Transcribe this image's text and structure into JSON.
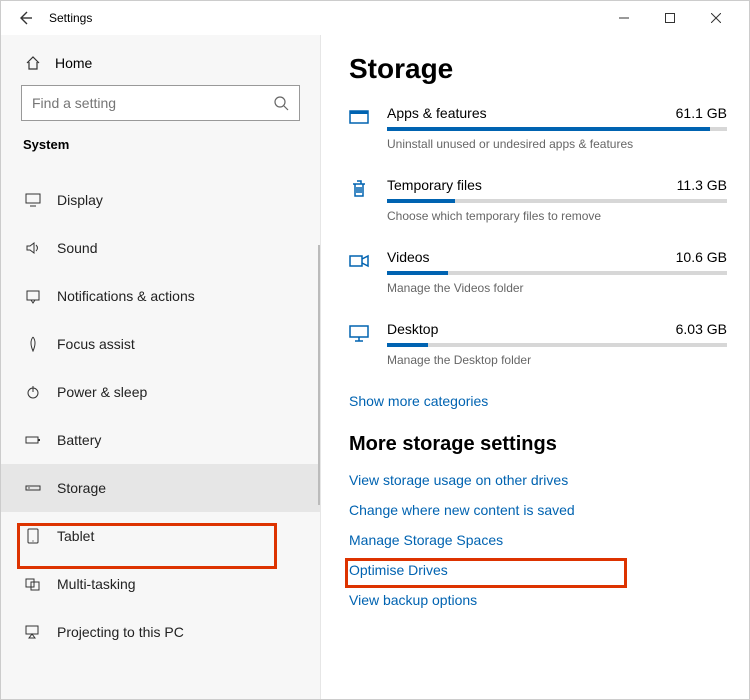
{
  "titlebar": {
    "title": "Settings"
  },
  "sidebar": {
    "home_label": "Home",
    "search_placeholder": "Find a setting",
    "section_label": "System",
    "items": [
      {
        "label": "Display"
      },
      {
        "label": "Sound"
      },
      {
        "label": "Notifications & actions"
      },
      {
        "label": "Focus assist"
      },
      {
        "label": "Power & sleep"
      },
      {
        "label": "Battery"
      },
      {
        "label": "Storage"
      },
      {
        "label": "Tablet"
      },
      {
        "label": "Multi-tasking"
      },
      {
        "label": "Projecting to this PC"
      }
    ]
  },
  "main": {
    "heading": "Storage",
    "categories": [
      {
        "name": "Apps & features",
        "size": "61.1 GB",
        "sub": "Uninstall unused or undesired apps & features",
        "fill_pct": 95
      },
      {
        "name": "Temporary files",
        "size": "11.3 GB",
        "sub": "Choose which temporary files to remove",
        "fill_pct": 20
      },
      {
        "name": "Videos",
        "size": "10.6 GB",
        "sub": "Manage the Videos folder",
        "fill_pct": 18
      },
      {
        "name": "Desktop",
        "size": "6.03 GB",
        "sub": "Manage the Desktop folder",
        "fill_pct": 12
      }
    ],
    "show_more": "Show more categories",
    "more_heading": "More storage settings",
    "more_links": [
      "View storage usage on other drives",
      "Change where new content is saved",
      "Manage Storage Spaces",
      "Optimise Drives",
      "View backup options"
    ]
  }
}
